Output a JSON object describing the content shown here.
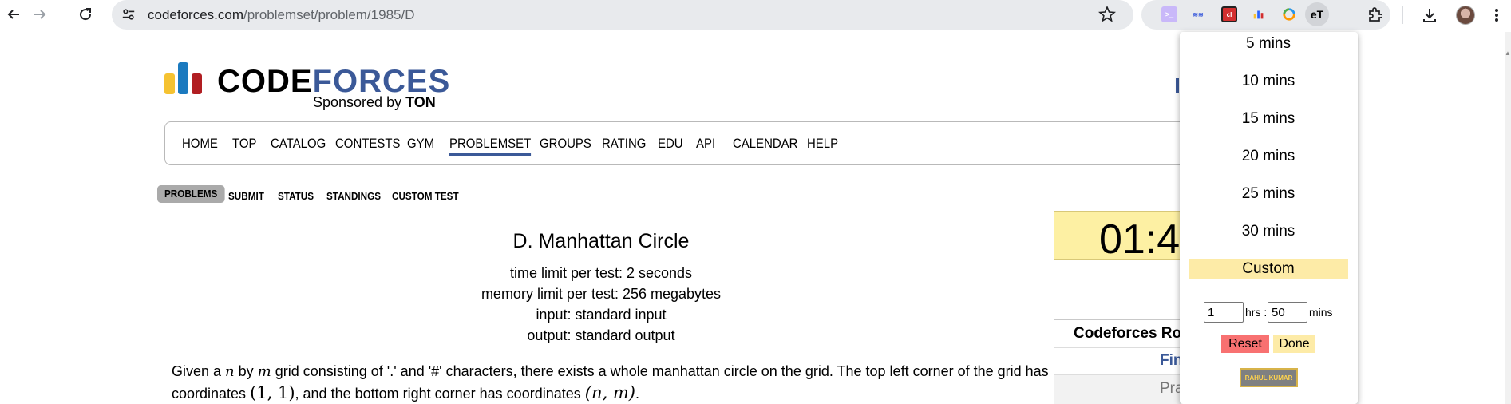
{
  "browser": {
    "url_host": "codeforces.com",
    "url_path": "/problemset/problem/1985/D",
    "icons": {
      "back": "arrow-left-icon",
      "forward": "arrow-right-icon",
      "reload": "reload-icon",
      "site_info": "tune-icon",
      "bookmark": "star-icon",
      "downloads": "download-icon",
      "extensions": "puzzle-icon",
      "menu": "kebab-menu-icon"
    },
    "extensions": [
      {
        "name": "extension-1-icon",
        "color": "#b9a4f5"
      },
      {
        "name": "extension-2-icon",
        "color": "#3b5bdb"
      },
      {
        "name": "extension-3-icon",
        "color": "#d32f2f"
      },
      {
        "name": "extension-4-icon",
        "color": "#2962ff"
      },
      {
        "name": "extension-5-icon",
        "color": "#ff9800"
      },
      {
        "name": "extension-timer-icon",
        "color": "#000000",
        "label": "eT"
      }
    ]
  },
  "logo": {
    "word_part1": "CODE",
    "word_part2": "FORCES",
    "sponsor_prefix": "Sponsored by",
    "sponsor_name": "TON"
  },
  "menu": [
    "HOME",
    "TOP",
    "CATALOG",
    "CONTESTS",
    "GYM",
    "PROBLEMSET",
    "GROUPS",
    "RATING",
    "EDU",
    "API",
    "CALENDAR",
    "HELP"
  ],
  "menu_active": "PROBLEMSET",
  "submenu": [
    "PROBLEMS",
    "SUBMIT",
    "STATUS",
    "STANDINGS",
    "CUSTOM TEST"
  ],
  "problem": {
    "title": "D. Manhattan Circle",
    "time_limit": "time limit per test: 2 seconds",
    "memory_limit": "memory limit per test: 256 megabytes",
    "input": "input: standard input",
    "output": "output: standard output",
    "statement_line1_a": "Given a ",
    "var_n": "n",
    "statement_by": " by ",
    "var_m": "m",
    "statement_line1_b": " grid consisting of '.' and '#' characters, there exists a whole manhattan circle on the grid. The top left corner of the grid has",
    "statement_line2_a": "coordinates ",
    "coord_tl": "(1, 1)",
    "statement_line2_b": ", and the bottom right corner has coordinates ",
    "coord_br": "(n, m)",
    "statement_line2_c": "."
  },
  "timer": {
    "display": "01:4"
  },
  "sidebar": {
    "round_title": "Codeforces Ro",
    "row1": "Fin",
    "row2": "Pra"
  },
  "popup": {
    "options": [
      "5 mins",
      "10 mins",
      "15 mins",
      "20 mins",
      "25 mins",
      "30 mins",
      "Custom"
    ],
    "hrs_value": "1",
    "hrs_label": "hrs :",
    "mins_value": "50",
    "mins_label": "mins",
    "reset_label": "Reset",
    "done_label": "Done",
    "author_badge": "RAHUL KUMAR",
    "colors": {
      "custom_bg": "#fdeba7",
      "reset_bg": "#f87171",
      "done_bg": "#fdeba7"
    }
  }
}
